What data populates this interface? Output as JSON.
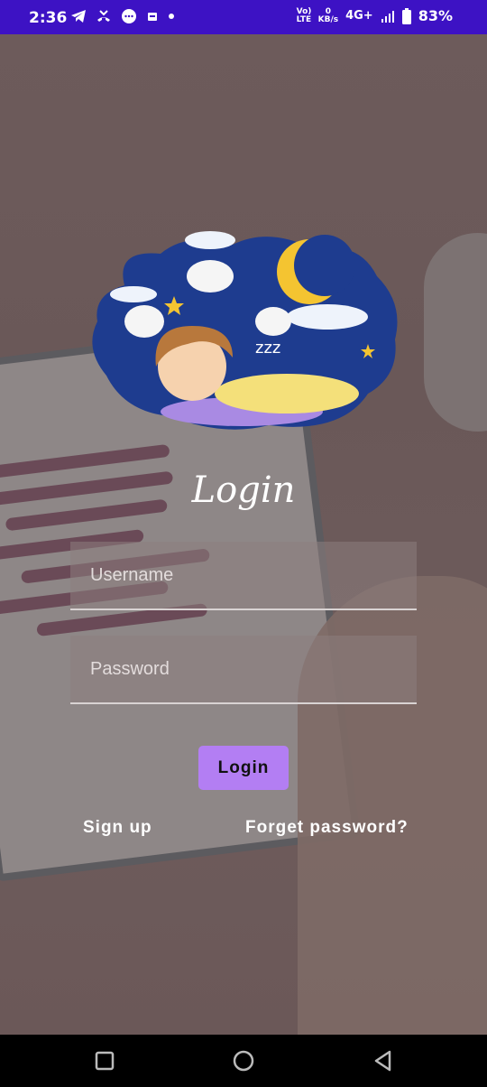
{
  "status_bar": {
    "time": "2:36",
    "network_label": "Vo) LTE",
    "data_speed_value": "0",
    "data_speed_unit": "KB/s",
    "network_type": "4G+",
    "battery_percent": "83%",
    "icons": [
      "telegram-icon",
      "missed-call-icon",
      "message-icon",
      "notification-icon",
      "dot-icon",
      "signal-icon",
      "battery-icon"
    ]
  },
  "login": {
    "title": "Login",
    "username_placeholder": "Username",
    "password_placeholder": "Password",
    "login_button": "Login",
    "signup_link": "Sign up",
    "forget_link": "Forget password?"
  },
  "nav_bar": {
    "icons": [
      "recent-apps-icon",
      "home-icon",
      "back-icon"
    ]
  },
  "colors": {
    "status_bar": "#3d12c4",
    "button": "#b37ef3",
    "nav_bar": "#000000"
  }
}
